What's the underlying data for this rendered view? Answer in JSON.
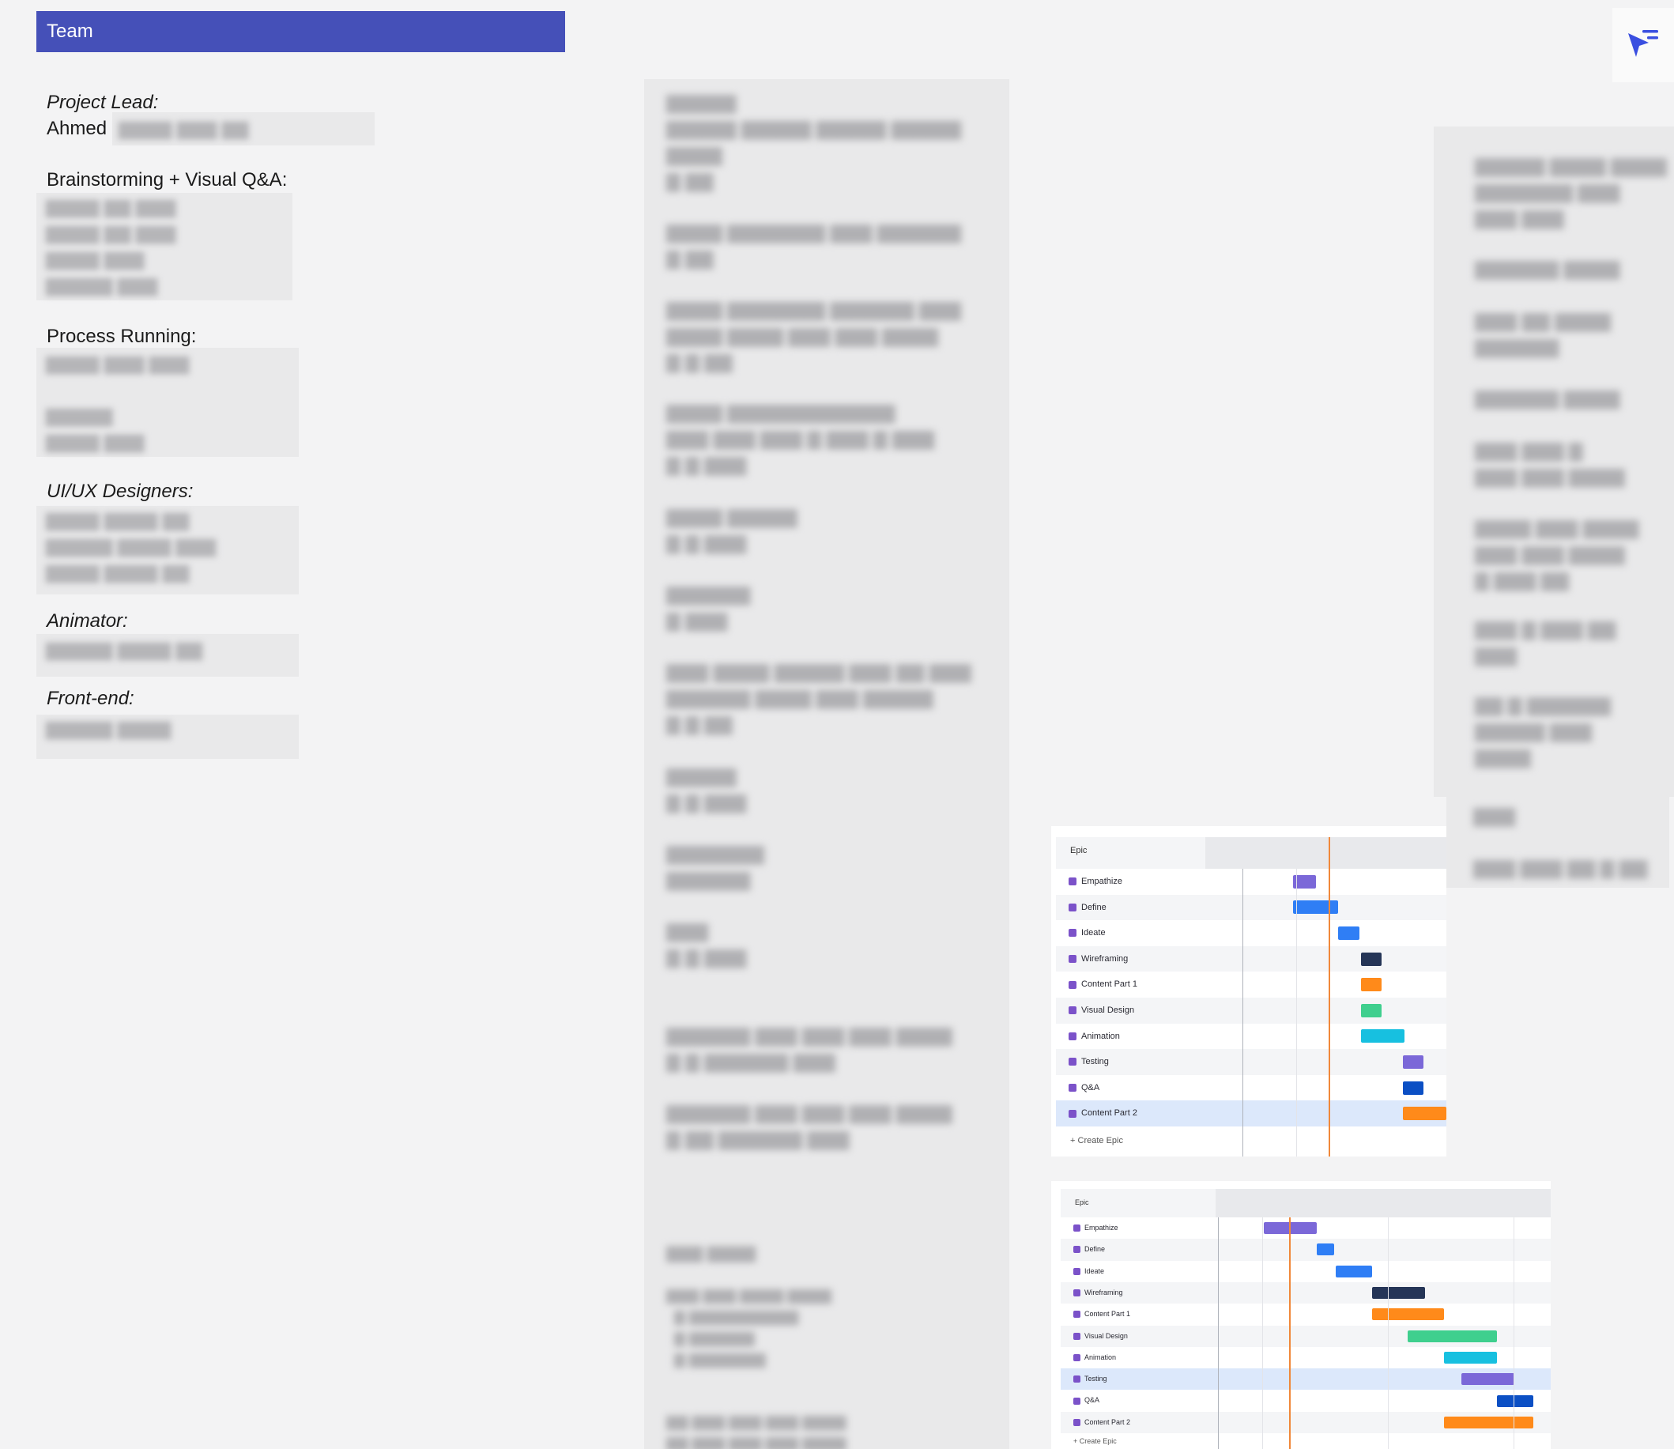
{
  "team": {
    "header": "Team",
    "project_lead_label": "Project Lead:",
    "project_lead_name": "Ahmed",
    "brainstorming_label": "Brainstorming + Visual Q&A:",
    "process_label": "Process Running:",
    "uiux_label": "UI/UX Designers:",
    "animator_label": "Animator:",
    "frontend_label": "Front-end:"
  },
  "gantt_top": {
    "header": "Epic",
    "rows": [
      {
        "label": "Empathize",
        "color": "#7b68d8",
        "start": 0.0,
        "len": 0.15
      },
      {
        "label": "Define",
        "color": "#2f7ef5",
        "start": 0.0,
        "len": 0.3
      },
      {
        "label": "Ideate",
        "color": "#2f7ef5",
        "start": 0.3,
        "len": 0.14
      },
      {
        "label": "Wireframing",
        "color": "#253557",
        "start": 0.45,
        "len": 0.14
      },
      {
        "label": "Content Part 1",
        "color": "#ff8a1a",
        "start": 0.45,
        "len": 0.14
      },
      {
        "label": "Visual Design",
        "color": "#3fcf8e",
        "start": 0.45,
        "len": 0.14
      },
      {
        "label": "Animation",
        "color": "#17c0e0",
        "start": 0.45,
        "len": 0.29
      },
      {
        "label": "Testing",
        "color": "#7b68d8",
        "start": 0.73,
        "len": 0.14
      },
      {
        "label": "Q&A",
        "color": "#0b4fc4",
        "start": 0.73,
        "len": 0.14
      },
      {
        "label": "Content Part 2",
        "color": "#ff8a1a",
        "start": 0.73,
        "len": 0.29
      }
    ],
    "create_label": "Create Epic",
    "highlight_row": 9
  },
  "gantt_bottom": {
    "header": "Epic",
    "rows": [
      {
        "label": "Empathize",
        "color": "#7b68d8",
        "start": 0.0,
        "len": 0.14
      },
      {
        "label": "Define",
        "color": "#2f7ef5",
        "start": 0.14,
        "len": 0.045
      },
      {
        "label": "Ideate",
        "color": "#2f7ef5",
        "start": 0.19,
        "len": 0.095
      },
      {
        "label": "Wireframing",
        "color": "#253557",
        "start": 0.285,
        "len": 0.14
      },
      {
        "label": "Content Part 1",
        "color": "#ff8a1a",
        "start": 0.285,
        "len": 0.19
      },
      {
        "label": "Visual Design",
        "color": "#3fcf8e",
        "start": 0.38,
        "len": 0.235
      },
      {
        "label": "Animation",
        "color": "#17c0e0",
        "start": 0.475,
        "len": 0.14
      },
      {
        "label": "Testing",
        "color": "#7b68d8",
        "start": 0.52,
        "len": 0.14
      },
      {
        "label": "Q&A",
        "color": "#0b4fc4",
        "start": 0.615,
        "len": 0.095
      },
      {
        "label": "Content Part 2",
        "color": "#ff8a1a",
        "start": 0.475,
        "len": 0.235
      }
    ],
    "create_label": "Create Epic",
    "highlight_row": 7
  }
}
